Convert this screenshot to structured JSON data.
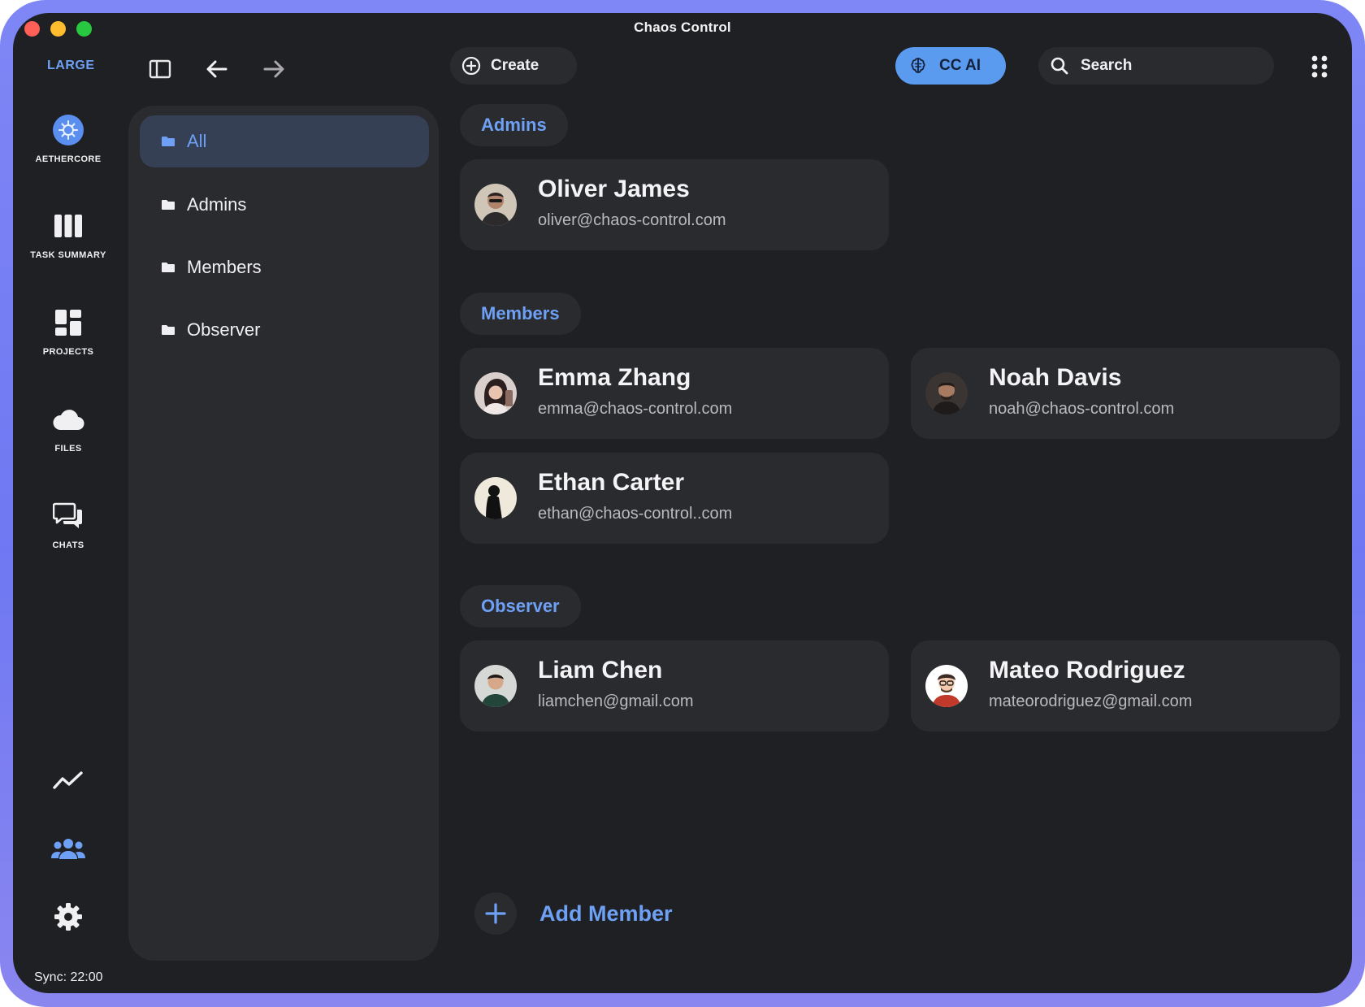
{
  "window": {
    "title": "Chaos Control"
  },
  "toolbar": {
    "size_label": "LARGE",
    "create_label": "Create",
    "ai_label": "CC AI",
    "search_placeholder": "Search"
  },
  "rail": {
    "workspace_label": "AETHERCORE",
    "items": [
      {
        "label": "TASK SUMMARY",
        "icon": "columns-icon"
      },
      {
        "label": "PROJECTS",
        "icon": "dashboard-icon"
      },
      {
        "label": "FILES",
        "icon": "cloud-icon"
      },
      {
        "label": "CHATS",
        "icon": "chat-icon"
      }
    ],
    "bottom_icons": [
      "analytics-icon",
      "team-icon",
      "settings-icon"
    ]
  },
  "status": {
    "sync": "Sync: 22:00"
  },
  "folders": [
    {
      "label": "All",
      "active": true
    },
    {
      "label": "Admins",
      "active": false
    },
    {
      "label": "Members",
      "active": false
    },
    {
      "label": "Observer",
      "active": false
    }
  ],
  "groups": {
    "admins": {
      "label": "Admins",
      "people": [
        {
          "name": "Oliver James",
          "email": "oliver@chaos-control.com"
        }
      ]
    },
    "members": {
      "label": "Members",
      "people": [
        {
          "name": "Emma Zhang",
          "email": "emma@chaos-control.com"
        },
        {
          "name": "Noah Davis",
          "email": "noah@chaos-control.com"
        },
        {
          "name": "Ethan Carter",
          "email": "ethan@chaos-control..com"
        }
      ]
    },
    "observer": {
      "label": "Observer",
      "people": [
        {
          "name": "Liam Chen",
          "email": "liamchen@gmail.com"
        },
        {
          "name": "Mateo Rodriguez",
          "email": "mateorodriguez@gmail.com"
        }
      ]
    }
  },
  "add_member_label": "Add Member",
  "colors": {
    "accent": "#6ea0f5",
    "ai_button": "#5a9bf0",
    "panel": "#2a2b2f",
    "background": "#1f2023",
    "frame": "#7f86f5"
  }
}
